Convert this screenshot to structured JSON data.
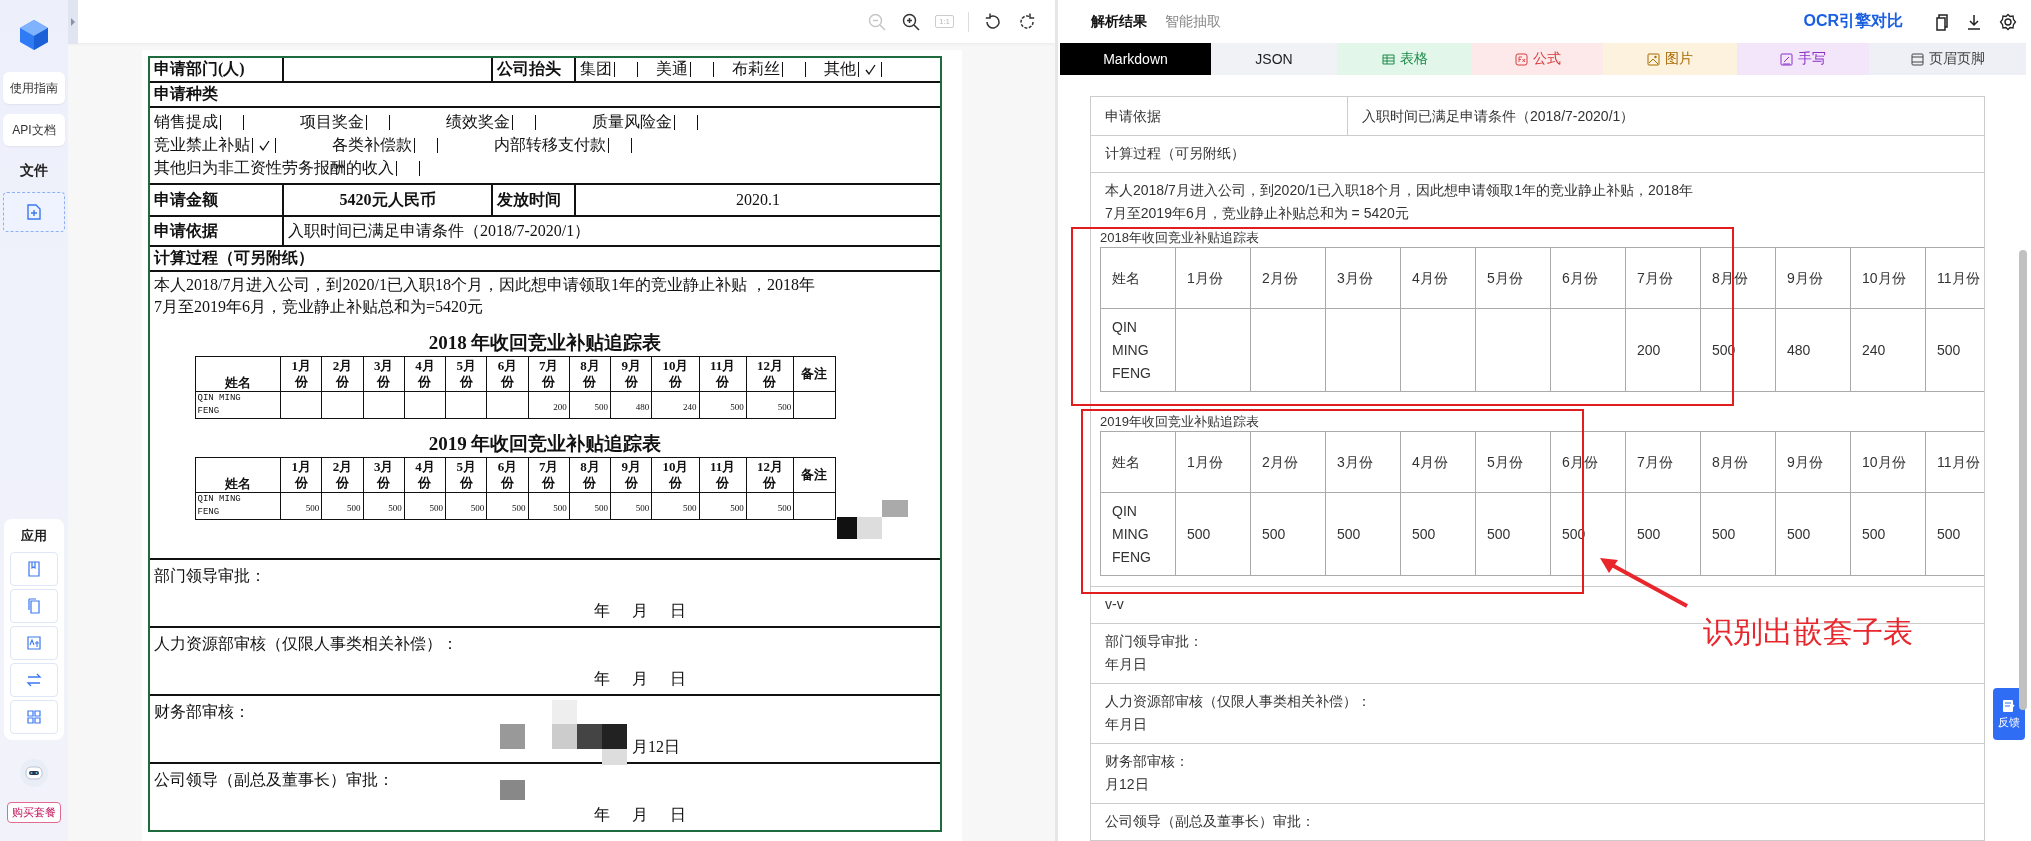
{
  "sidebar": {
    "guide_button": "使用指南",
    "api_button": "API文档",
    "files_label": "文件",
    "apps_label": "应用",
    "buy_button": "购买套餐"
  },
  "viewer": {
    "fit_label": "1:1",
    "document": {
      "dept_label": "申请部门(人)",
      "company_label": "公司抬头",
      "company_options": [
        {
          "label": "集团",
          "checked": false
        },
        {
          "label": "美通",
          "checked": false
        },
        {
          "label": "布莉丝",
          "checked": false
        },
        {
          "label": "其他",
          "checked": true
        }
      ],
      "type_label": "申请种类",
      "type_lines": [
        {
          "options": [
            {
              "label": "销售提成",
              "checked": false
            },
            {
              "label": "项目奖金",
              "checked": false
            },
            {
              "label": "绩效奖金",
              "checked": false
            },
            {
              "label": "质量风险金",
              "checked": false
            }
          ]
        },
        {
          "options": [
            {
              "label": "竞业禁止补贴",
              "checked": true
            },
            {
              "label": "各类补偿款",
              "checked": false
            },
            {
              "label": "内部转移支付款",
              "checked": false
            }
          ]
        },
        {
          "options": [
            {
              "label": "其他归为非工资性劳务报酬的收入",
              "checked": false
            }
          ]
        }
      ],
      "amount_label": "申请金额",
      "amount": "5420元人民币",
      "date_label": "发放时间",
      "date": "2020.1",
      "basis_label": "申请依据",
      "basis": "入职时间已满足申请条件（2018/7-2020/1）",
      "calc_label": "计算过程（可另附纸）",
      "calc_lines": [
        "本人2018/7月进入公司，到2020/1已入职18个月，因此想申请领取1年的竞业静止补贴 ，2018年",
        "7月至2019年6月，竞业静止补贴总和为=5420元"
      ],
      "tables": [
        {
          "title": "2018 年收回竞业补贴追踪表",
          "columns": [
            "姓名",
            "1月份",
            "2月份",
            "3月份",
            "4月份",
            "5月份",
            "6月份",
            "7月份",
            "8月份",
            "9月份",
            "10月份",
            "11月份",
            "12月份",
            "备注"
          ],
          "rows": [
            {
              "cells": [
                {
                  "kind": "name",
                  "value": "QIN MING FENG"
                },
                {
                  "kind": "blank"
                },
                {
                  "kind": "blank"
                },
                {
                  "kind": "blank"
                },
                {
                  "kind": "blank"
                },
                {
                  "kind": "blank"
                },
                {
                  "kind": "blank"
                },
                {
                  "kind": "amount",
                  "value": "200"
                },
                {
                  "kind": "amount",
                  "value": "500"
                },
                {
                  "kind": "amount",
                  "value": "480"
                },
                {
                  "kind": "amount",
                  "value": "240"
                },
                {
                  "kind": "amount",
                  "value": "500"
                },
                {
                  "kind": "amount",
                  "value": "500"
                },
                {
                  "kind": "blank"
                }
              ]
            }
          ]
        },
        {
          "title": "2019 年收回竞业补贴追踪表",
          "columns": [
            "姓名",
            "1月份",
            "2月份",
            "3月份",
            "4月份",
            "5月份",
            "6月份",
            "7月份",
            "8月份",
            "9月份",
            "10月份",
            "11月份",
            "12月份",
            "备注"
          ],
          "rows": [
            {
              "cells": [
                {
                  "kind": "name",
                  "value": "QIN MING FENG"
                },
                {
                  "kind": "amount",
                  "value": "500"
                },
                {
                  "kind": "amount",
                  "value": "500"
                },
                {
                  "kind": "amount",
                  "value": "500"
                },
                {
                  "kind": "amount",
                  "value": "500"
                },
                {
                  "kind": "amount",
                  "value": "500"
                },
                {
                  "kind": "amount",
                  "value": "500"
                },
                {
                  "kind": "amount",
                  "value": "500"
                },
                {
                  "kind": "amount",
                  "value": "500"
                },
                {
                  "kind": "amount",
                  "value": "500"
                },
                {
                  "kind": "amount",
                  "value": "500"
                },
                {
                  "kind": "amount",
                  "value": "500"
                },
                {
                  "kind": "amount",
                  "value": "500"
                },
                {
                  "kind": "blank"
                }
              ]
            }
          ]
        }
      ],
      "approvals": [
        {
          "label": "部门领导审批：",
          "date": "年 月 日"
        },
        {
          "label": "人力资源部审核（仅限人事类相关补偿）：",
          "date": "年 月 日"
        },
        {
          "label": "财务部审核：",
          "date": "月12日"
        },
        {
          "label": "公司领导（副总及董事长）审批：",
          "date": "年 月 日"
        }
      ]
    }
  },
  "results": {
    "tabs": [
      {
        "label": "解析结果",
        "selected": true
      },
      {
        "label": "智能抽取",
        "selected": false
      }
    ],
    "compare_link": "OCR引擎对比",
    "format_tabs": [
      {
        "label": "Markdown",
        "kind": "markdown",
        "selected": true,
        "color": "#000000"
      },
      {
        "label": "JSON",
        "kind": "json",
        "selected": false,
        "color": "#f0f2f5"
      },
      {
        "label": "表格",
        "kind": "table",
        "selected": false,
        "color": "#e2f7ea"
      },
      {
        "label": "公式",
        "kind": "formula",
        "selected": false,
        "color": "#fde9ea"
      },
      {
        "label": "图片",
        "kind": "image",
        "selected": false,
        "color": "#fdf2dd"
      },
      {
        "label": "手写",
        "kind": "handwriting",
        "selected": false,
        "color": "#f3e6fb"
      },
      {
        "label": "页眉页脚",
        "kind": "header",
        "selected": false,
        "color": "#eef0f5"
      }
    ],
    "rows": [
      {
        "kind": "pair",
        "label": "申请依据",
        "value": "入职时间已满足申请条件（2018/7-2020/1）"
      },
      {
        "kind": "text",
        "lines": [
          "计算过程（可另附纸）"
        ]
      },
      {
        "kind": "nested",
        "lines": [
          "本人2018/7月进入公司，到2020/1已入职18个月，因此想申请领取1年的竞业静止补贴，2018年",
          "7月至2019年6月，竞业静止补贴总和为 = 5420元"
        ],
        "tables": [
          {
            "title": "2018年收回竞业补贴追踪表",
            "highlighted": true,
            "columns": [
              "姓名",
              "1月份",
              "2月份",
              "3月份",
              "4月份",
              "5月份",
              "6月份",
              "7月份",
              "8月份",
              "9月份",
              "10月份",
              "11月份"
            ],
            "rows": [
              {
                "cells": [
                  {
                    "kind": "name",
                    "value": "QIN MING FENG"
                  },
                  {
                    "kind": "blank"
                  },
                  {
                    "kind": "blank"
                  },
                  {
                    "kind": "blank"
                  },
                  {
                    "kind": "blank"
                  },
                  {
                    "kind": "blank"
                  },
                  {
                    "kind": "blank"
                  },
                  {
                    "kind": "amount",
                    "value": "200"
                  },
                  {
                    "kind": "amount",
                    "value": "500"
                  },
                  {
                    "kind": "amount",
                    "value": "480"
                  },
                  {
                    "kind": "amount",
                    "value": "240"
                  },
                  {
                    "kind": "amount",
                    "value": "500"
                  }
                ]
              }
            ]
          },
          {
            "title": "2019年收回竞业补贴追踪表",
            "highlighted": true,
            "columns": [
              "姓名",
              "1月份",
              "2月份",
              "3月份",
              "4月份",
              "5月份",
              "6月份",
              "7月份",
              "8月份",
              "9月份",
              "10月份",
              "11月份"
            ],
            "rows": [
              {
                "cells": [
                  {
                    "kind": "name",
                    "value": "QIN MING FENG"
                  },
                  {
                    "kind": "amount",
                    "value": "500"
                  },
                  {
                    "kind": "amount",
                    "value": "500"
                  },
                  {
                    "kind": "amount",
                    "value": "500"
                  },
                  {
                    "kind": "amount",
                    "value": "500"
                  },
                  {
                    "kind": "amount",
                    "value": "500"
                  },
                  {
                    "kind": "amount",
                    "value": "500"
                  },
                  {
                    "kind": "amount",
                    "value": "500"
                  },
                  {
                    "kind": "amount",
                    "value": "500"
                  },
                  {
                    "kind": "amount",
                    "value": "500"
                  },
                  {
                    "kind": "amount",
                    "value": "500"
                  },
                  {
                    "kind": "amount",
                    "value": "500"
                  }
                ]
              }
            ]
          }
        ]
      },
      {
        "kind": "text",
        "lines": [
          "v-v"
        ]
      },
      {
        "kind": "text",
        "lines": [
          "部门领导审批：",
          "年月日"
        ]
      },
      {
        "kind": "text",
        "lines": [
          "人力资源部审核（仅限人事类相关补偿）：",
          "年月日"
        ]
      },
      {
        "kind": "text",
        "lines": [
          "财务部审核：",
          "月12日"
        ]
      },
      {
        "kind": "text",
        "lines": [
          "公司领导（副总及董事长）审批："
        ]
      }
    ],
    "annotation": {
      "label": "识别出嵌套子表"
    },
    "feedback": "反馈"
  }
}
